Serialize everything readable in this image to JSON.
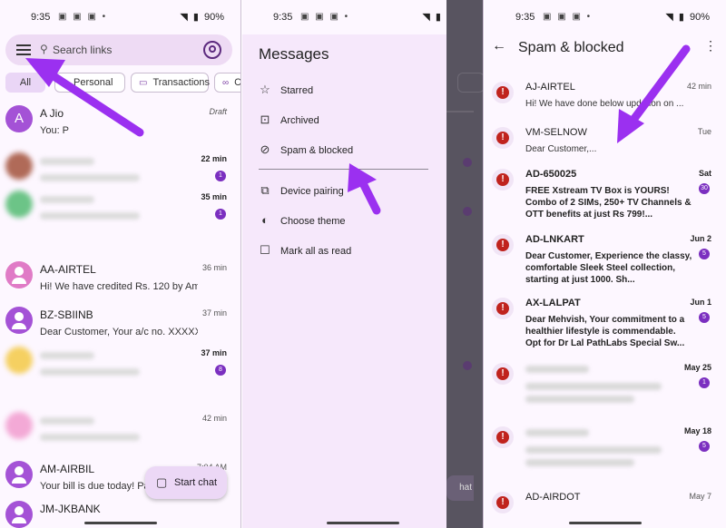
{
  "status": {
    "time": "9:35",
    "battery": "90%"
  },
  "panel1": {
    "search_placeholder": "Search links",
    "chips": [
      {
        "label": "All"
      },
      {
        "label": "Personal"
      },
      {
        "label": "Transactions"
      },
      {
        "label": "C"
      }
    ],
    "conversations": [
      {
        "avatar_letter": "A",
        "avatar_color": "#a452d6",
        "name": "A Jio",
        "snippet": "You: P",
        "time": "Draft"
      },
      {
        "avatar_color": "#b06a58",
        "time": "22 min",
        "badge": "1"
      },
      {
        "avatar_color": "#6cc487",
        "time": "35 min",
        "badge": "1"
      },
      {
        "avatar_color": "#e07bc6",
        "name": "AA-AIRTEL",
        "snippet": "Hi! We have credited Rs. 120 by Ama...",
        "time": "36 min"
      },
      {
        "avatar_color": "#a452d6",
        "name": "BZ-SBIINB",
        "snippet": "Dear Customer, Your a/c no. XXXXXX...",
        "time": "37 min"
      },
      {
        "avatar_color": "#f5d061",
        "time": "37 min",
        "badge": "8"
      },
      {
        "avatar_color": "#f3a9d6",
        "time": "42 min"
      },
      {
        "avatar_color": "#a452d6",
        "name": "AM-AIRBIL",
        "snippet": "Your bill is due today! Pay",
        "time": "7:04 AM"
      },
      {
        "avatar_color": "#a452d6",
        "name": "JM-JKBANK"
      }
    ],
    "fab_label": "Start chat"
  },
  "panel2": {
    "drawer_title": "Messages",
    "items": [
      {
        "icon": "star-icon",
        "label": "Starred"
      },
      {
        "icon": "archive-icon",
        "label": "Archived"
      },
      {
        "icon": "block-icon",
        "label": "Spam & blocked"
      },
      {
        "icon": "devices-icon",
        "label": "Device pairing"
      },
      {
        "icon": "theme-icon",
        "label": "Choose theme"
      },
      {
        "icon": "mark-read-icon",
        "label": "Mark all as read"
      }
    ],
    "behind_fragment": "hat"
  },
  "panel3": {
    "title": "Spam & blocked",
    "items": [
      {
        "sender": "AJ-AIRTEL",
        "snippet": "Hi! We have done below updation on ...",
        "time": "42 min",
        "bold": false
      },
      {
        "sender": "VM-SELNOW",
        "snippet": "Dear Customer,...",
        "time": "Tue",
        "bold": false
      },
      {
        "sender": "AD-650025",
        "snippet": "FREE Xstream TV Box is YOURS! Combo of 2 SIMs, 250+ TV Channels & OTT benefits at just Rs 799!...",
        "time": "Sat",
        "badge": "30",
        "bold": true
      },
      {
        "sender": "AD-LNKART",
        "snippet": "Dear Customer, Experience the classy, comfortable Sleek Steel collection, starting at just 1000. Sh...",
        "time": "Jun 2",
        "badge": "5",
        "bold": true
      },
      {
        "sender": "AX-LALPAT",
        "snippet": "Dear Mehvish, Your commitment to a healthier lifestyle is commendable. Opt for Dr Lal PathLabs Special Sw...",
        "time": "Jun 1",
        "badge": "5",
        "bold": true
      },
      {
        "time": "May 25",
        "badge": "1",
        "bold": true
      },
      {
        "time": "May 18",
        "badge": "5",
        "bold": true
      },
      {
        "sender": "AD-AIRDOT",
        "time": "May 7",
        "bold": false
      }
    ]
  },
  "accent": "#9b30f0"
}
